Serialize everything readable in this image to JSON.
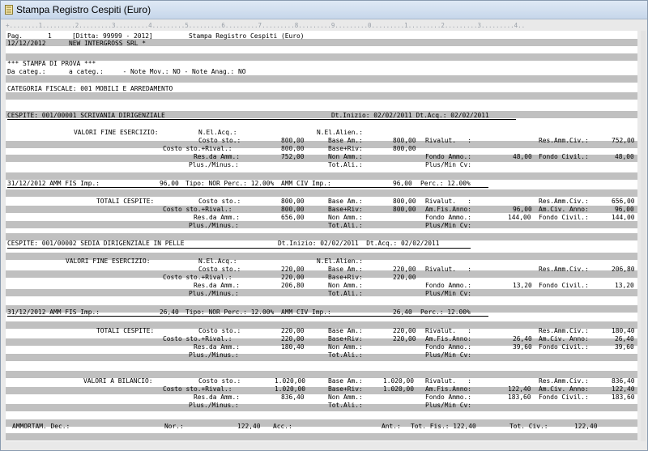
{
  "window": {
    "title": "Stampa Registro Cespiti (Euro)"
  },
  "ruler": "+........1.........2.........3.........4.........5.........6.........7.........8.........9.........0.........1.........2.........3.........4..",
  "report": {
    "page_label": "Pag.",
    "page_number": "1",
    "ditta": "[Ditta: 99999 - 2012]",
    "report_title": "Stampa Registro Cespiti (Euro)",
    "date": "12/12/2012",
    "company": "NEW INTERGROSS SRL *",
    "test_banner": "*** STAMPA DI PROVA ***",
    "filters": "Da categ.:      a categ.:     - Note Mov.: NO - Note Anag.: NO",
    "category": "CATEGORIA FISCALE: 001 MOBILI E ARREDAMENTO",
    "assets": [
      {
        "header": "CESPITE: 001/00001 SCRIVANIA DIRIGENZIALE",
        "dates": "Dt.Inizio: 02/02/2011 Dt.Acq.: 02/02/2011",
        "vfe_title": "VALORI FINE ESERCIZIO:",
        "vfe": {
          "nel_acq": "N.El.Acq.:",
          "nel_alien": "N.El.Alien.:",
          "costo": "Costo sto.:",
          "costo_v": "800,00",
          "base_am": "Base Am.:",
          "base_am_v": "800,00",
          "rivalut": "Rivalut.   :",
          "res_civ": "Res.Amm.Civ.:",
          "res_civ_v": "752,00",
          "costo_riv": "Costo sto.+Rival.:",
          "costo_riv_v": "800,00",
          "base_riv": "Base+Riv:",
          "base_riv_v": "800,00",
          "res_amm": "Res.da Amm.:",
          "res_amm_v": "752,00",
          "non_amm": "Non Amm.:",
          "fondo": "Fondo Ammo.:",
          "fondo_v": "48,00",
          "fondo_civ": "Fondo Civil.:",
          "fondo_civ_v": "48,00",
          "plus": "Plus./Minus.:",
          "tot": "Tot.Ali.:",
          "plusmin": "Plus/Min Cv:"
        },
        "amm": {
          "date": "31/12/2012 AMM FIS Imp.:",
          "imp_v": "96,00",
          "tipo": "Tipo: NOR Perc.: 12.00%",
          "civ": "AMM CIV Imp.:",
          "civ_v": "96,00",
          "perc": "Perc.: 12.00%"
        },
        "tot_title": "TOTALI CESPITE:",
        "tot": {
          "costo": "Costo sto.:",
          "costo_v": "800,00",
          "base_am": "Base Am.:",
          "base_am_v": "800,00",
          "rivalut": "Rivalut.   :",
          "res_civ": "Res.Amm.Civ.:",
          "res_civ_v": "656,00",
          "costo_riv": "Costo sto.+Rival.:",
          "costo_riv_v": "800,00",
          "base_riv": "Base+Riv:",
          "base_riv_v": "800,00",
          "amfis": "Am.Fis.Anno:",
          "amfis_v": "96,00",
          "amciv": "Am.Civ. Anno:",
          "amciv_v": "96,00",
          "res_amm": "Res.da Amm.:",
          "res_amm_v": "656,00",
          "non_amm": "Non Amm.:",
          "fondo": "Fondo Ammo.:",
          "fondo_v": "144,00",
          "fondo_civ": "Fondo Civil.:",
          "fondo_civ_v": "144,00",
          "plus": "Plus./Minus.:",
          "tot": "Tot.Ali.:",
          "plusmin": "Plus/Min Cv:"
        }
      },
      {
        "header": "CESPITE: 001/00002 SEDIA DIRIGENZIALE IN PELLE",
        "dates": "Dt.Inizio: 02/02/2011  Dt.Acq.: 02/02/2011",
        "vfe_title": "VALORI FINE ESERCIZIO:",
        "vfe": {
          "nel_acq": "N.El.Acq.:",
          "nel_alien": "N.El.Alien.:",
          "costo": "Costo sto.:",
          "costo_v": "220,00",
          "base_am": "Base Am.:",
          "base_am_v": "220,00",
          "rivalut": "Rivalut.   :",
          "res_civ": "Res.Amm.Civ.:",
          "res_civ_v": "206,80",
          "costo_riv": "Costo sto.+Rival.:",
          "costo_riv_v": "220,00",
          "base_riv": "Base+Riv:",
          "base_riv_v": "220,00",
          "res_amm": "Res.da Amm.:",
          "res_amm_v": "206,80",
          "non_amm": "Non Amm.:",
          "fondo": "Fondo Ammo.:",
          "fondo_v": "13,20",
          "fondo_civ": "Fondo Civil.:",
          "fondo_civ_v": "13,20",
          "plus": "Plus./Minus.:",
          "tot": "Tot.Ali.:",
          "plusmin": "Plus/Min Cv:"
        },
        "amm": {
          "date": "31/12/2012 AMM FIS Imp.:",
          "imp_v": "26,40",
          "tipo": "Tipo: NOR Perc.: 12.00%",
          "civ": "AMM CIV Imp.:",
          "civ_v": "26,40",
          "perc": "Perc.: 12.00%"
        },
        "tot_title": "TOTALI CESPITE:",
        "tot": {
          "costo": "Costo sto.:",
          "costo_v": "220,00",
          "base_am": "Base Am.:",
          "base_am_v": "220,00",
          "rivalut": "Rivalut.   :",
          "res_civ": "Res.Amm.Civ.:",
          "res_civ_v": "180,40",
          "costo_riv": "Costo sto.+Rival.:",
          "costo_riv_v": "220,00",
          "base_riv": "Base+Riv:",
          "base_riv_v": "220,00",
          "amfis": "Am.Fis.Anno:",
          "amfis_v": "26,40",
          "amciv": "Am.Civ. Anno:",
          "amciv_v": "26,40",
          "res_amm": "Res.da Amm.:",
          "res_amm_v": "180,40",
          "non_amm": "Non Amm.:",
          "fondo": "Fondo Ammo.:",
          "fondo_v": "39,60",
          "fondo_civ": "Fondo Civil.:",
          "fondo_civ_v": "39,60",
          "plus": "Plus./Minus.:",
          "tot": "Tot.Ali.:",
          "plusmin": "Plus/Min Cv:"
        }
      }
    ],
    "bilancio": {
      "title": "VALORI A BILANCIO:",
      "costo": "Costo sto.:",
      "costo_v": "1.020,00",
      "base_am": "Base Am.:",
      "base_am_v": "1.020,00",
      "rivalut": "Rivalut.   :",
      "res_civ": "Res.Amm.Civ.:",
      "res_civ_v": "836,40",
      "costo_riv": "Costo sto.+Rival.:",
      "costo_riv_v": "1.020,00",
      "base_riv": "Base+Riv:",
      "base_riv_v": "1.020,00",
      "amfis": "Am.Fis.Anno:",
      "amfis_v": "122,40",
      "amciv": "Am.Civ. Anno:",
      "amciv_v": "122,40",
      "res_amm": "Res.da Amm.:",
      "res_amm_v": "836,40",
      "non_amm": "Non Amm.:",
      "fondo": "Fondo Ammo.:",
      "fondo_v": "183,60",
      "fondo_civ": "Fondo Civil.:",
      "fondo_civ_v": "183,60",
      "plus": "Plus./Minus.:",
      "tot": "Tot.Ali.:",
      "plusmin": "Plus/Min Cv:"
    },
    "footer": {
      "label": "AMMORTAM. Dec.:",
      "nor": "Nor.:",
      "nor_v": "122,40",
      "acc": "Acc.:",
      "ant": "Ant.:",
      "totfis": "Tot. Fis.: 122,40",
      "totciv": "Tot. Civ.:",
      "totciv_v": "122,40"
    }
  }
}
